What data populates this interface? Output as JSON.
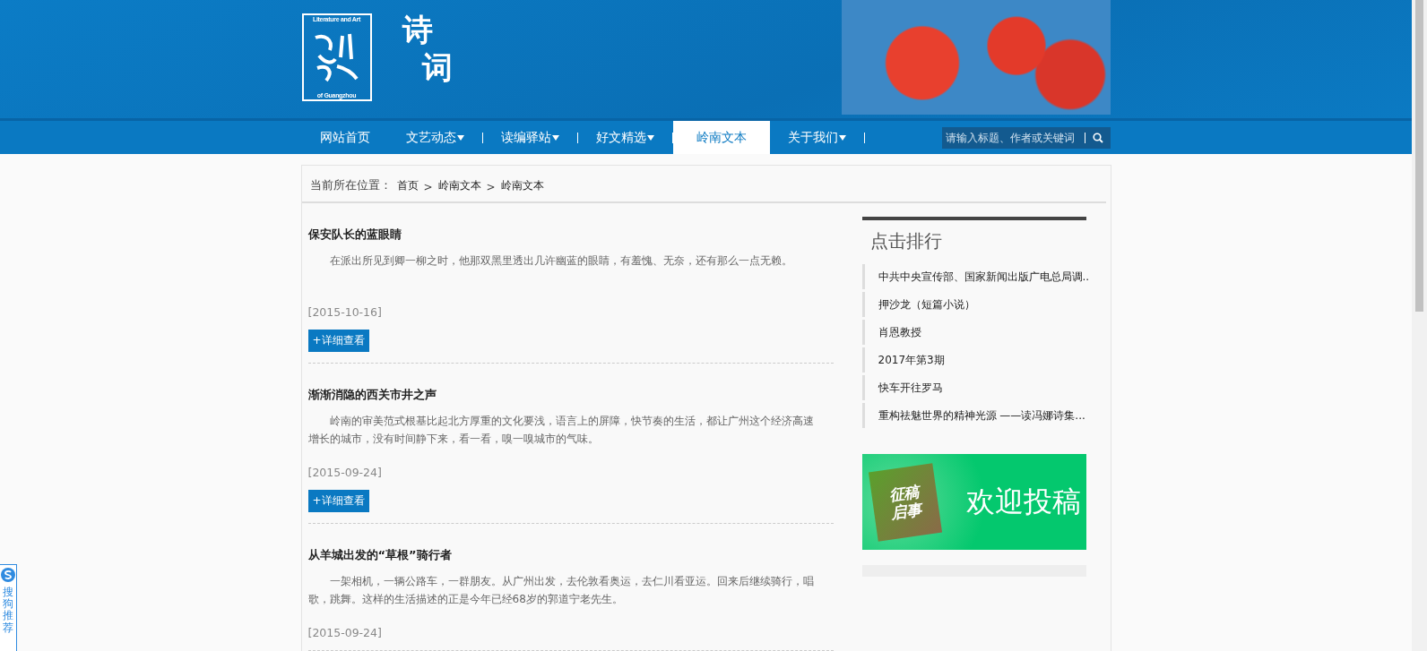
{
  "header": {
    "logo": {
      "top": "Literature and Art",
      "bottom": "of Guangzhou"
    },
    "section_title": [
      "诗",
      "词"
    ]
  },
  "nav": {
    "items": [
      {
        "label": "网站首页",
        "dropdown": false,
        "selected": false
      },
      {
        "label": "文艺动态",
        "dropdown": true,
        "selected": false
      },
      {
        "label": "读编驿站",
        "dropdown": true,
        "selected": false
      },
      {
        "label": "好文精选",
        "dropdown": true,
        "selected": false
      },
      {
        "label": "岭南文本",
        "dropdown": false,
        "selected": true
      },
      {
        "label": "关于我们",
        "dropdown": true,
        "selected": false
      }
    ],
    "search": {
      "placeholder": "请输入标题、作者或关键词"
    }
  },
  "breadcrumb": {
    "label": "当前所在位置：",
    "separator": ">",
    "items": [
      "首页",
      "岭南文本",
      "岭南文本"
    ]
  },
  "articles": [
    {
      "title": "保安队长的蓝眼睛",
      "summary": "在派出所见到卿一柳之时，他那双黑里透出几许幽蓝的眼睛，有羞愧、无奈，还有那么一点无赖。",
      "date": "[2015-10-16]",
      "button": "+详细查看"
    },
    {
      "title": "渐渐消隐的西关市井之声",
      "summary": "岭南的审美范式根基比起北方厚重的文化要浅，语言上的屏障，快节奏的生活，都让广州这个经济高速增长的城市，没有时间静下来，看一看，嗅一嗅城市的气味。",
      "date": "[2015-09-24]",
      "button": "+详细查看"
    },
    {
      "title": "从羊城出发的“草根”骑行者",
      "summary": "一架相机，一辆公路车，一群朋友。从广州出发，去伦敦看奥运，去仁川看亚运。回来后继续骑行，唱歌，跳舞。这样的生活描述的正是今年已经68岁的郭道宁老先生。",
      "date": "[2015-09-24]"
    }
  ],
  "ranking": {
    "title": "点击排行",
    "items": [
      "中共中央宣传部、国家新闻出版广电总局调..",
      "押沙龙（短篇小说）",
      "肖恩教授",
      "2017年第3期",
      "快车开往罗马",
      "重构祛魅世界的精神光源 ——读冯娜诗集..."
    ]
  },
  "banner": {
    "badge": [
      "征稿",
      "启事"
    ],
    "text": "欢迎投稿"
  },
  "side_widget": {
    "text": "搜狗推荐"
  }
}
